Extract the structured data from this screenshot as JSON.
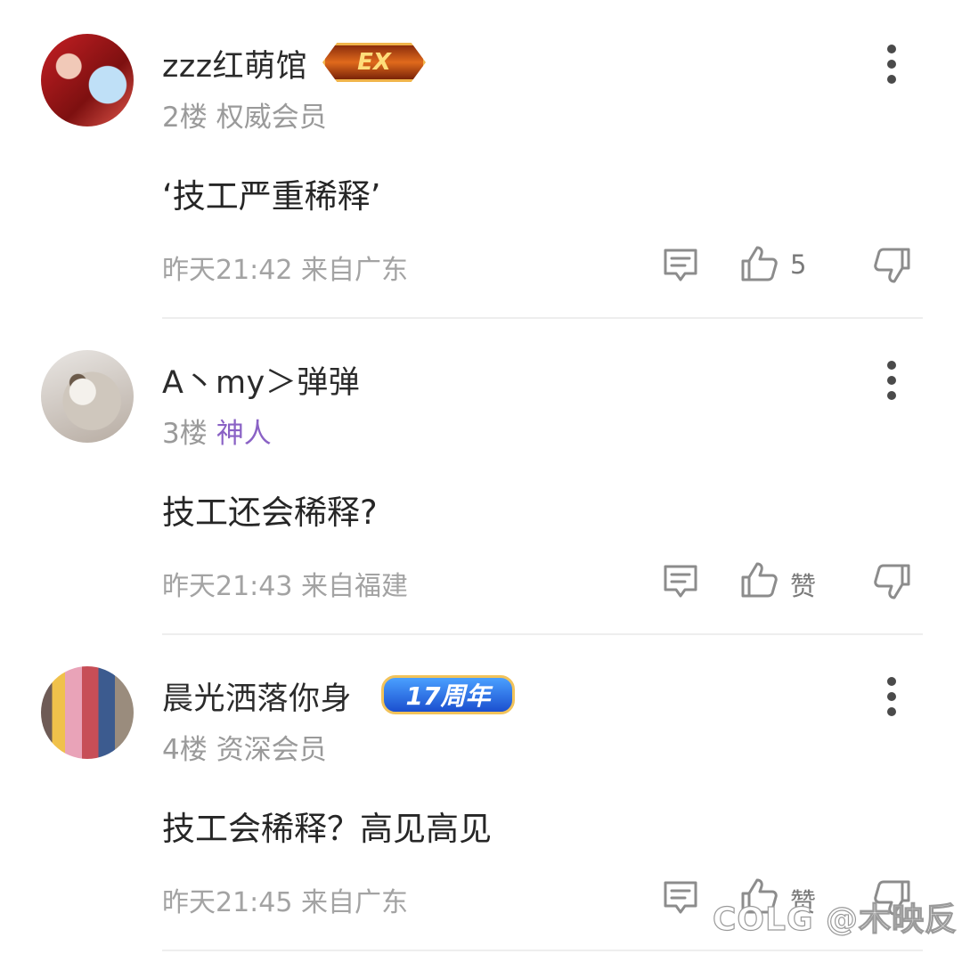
{
  "comments": [
    {
      "username": "zzz红萌馆",
      "badge": "EX",
      "floor": "2楼",
      "title": "权威会员",
      "content": "‘技工严重稀释’",
      "time_location": "昨天21:42 来自广东",
      "like_label": "5"
    },
    {
      "username": "A丶my＞弹弹",
      "badge": "",
      "floor": "3楼",
      "title": "神人",
      "content": "技工还会稀释?",
      "time_location": "昨天21:43 来自福建",
      "like_label": "赞"
    },
    {
      "username": "晨光洒落你身",
      "badge": "17周年",
      "floor": "4楼",
      "title": "资深会员",
      "content": "技工会稀释？高见高见",
      "time_location": "昨天21:45 来自广东",
      "like_label": "赞"
    }
  ],
  "watermark": "COLG @木映反",
  "colors": {
    "title_purple": "#8a62c5",
    "meta_gray": "#9a9a9a",
    "icon_gray": "#8c8c8c"
  },
  "icons": [
    "more-vertical-icon",
    "reply-icon",
    "thumbs-up-icon",
    "thumbs-down-icon"
  ]
}
